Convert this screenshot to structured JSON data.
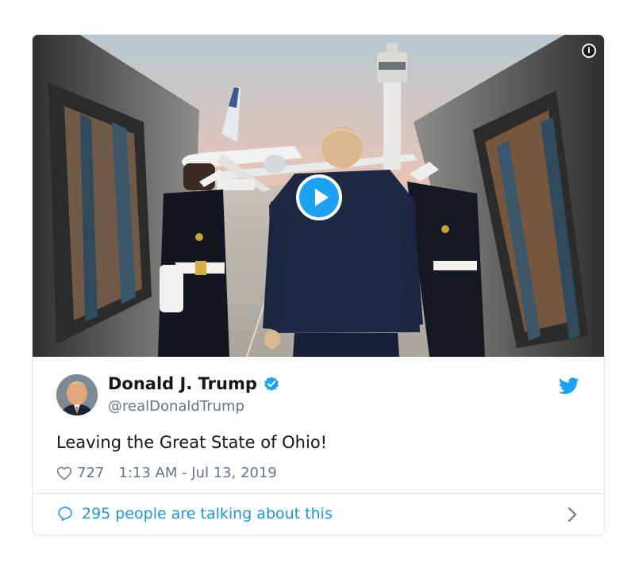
{
  "tweet": {
    "author_name": "Donald J. Trump",
    "handle": "@realDonaldTrump",
    "text": "Leaving the Great State of Ohio!",
    "likes": "727",
    "timestamp": "1:13 AM - Jul 13, 2019",
    "talking": "295 people are talking about this",
    "verified": true
  },
  "media": {
    "type": "video",
    "info_icon": "info-icon",
    "play_icon": "play-icon"
  },
  "icons": {
    "verified": "verified-badge-icon",
    "brand": "twitter-bird-icon",
    "like": "heart-icon",
    "reply": "speech-bubble-icon",
    "next": "chevron-right-icon"
  },
  "colors": {
    "brand_blue": "#1da1f2",
    "link_blue": "#1b95e0",
    "secondary_text": "#657786",
    "border": "#e1e8ed"
  }
}
